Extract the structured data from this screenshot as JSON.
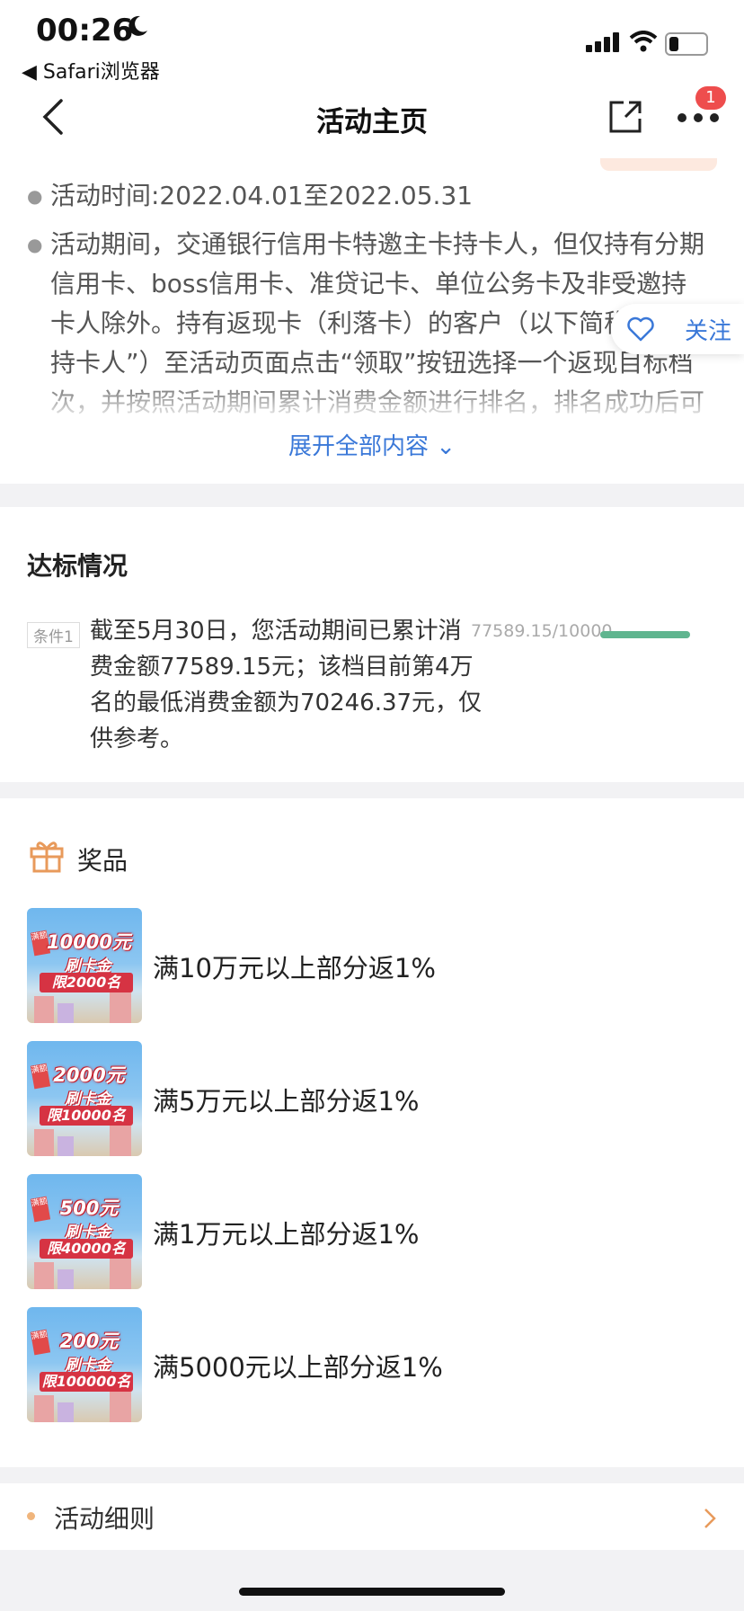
{
  "status": {
    "time": "00:26",
    "back_app": "◀ Safari浏览器"
  },
  "nav": {
    "title": "活动主页",
    "badge": "1"
  },
  "intro": {
    "time_text": "活动时间:2022.04.01至2022.05.31",
    "desc": "活动期间，交通银行信用卡特邀主卡持卡人，但仅持有分期信用卡、boss信用卡、准贷记卡、单位公务卡及非受邀持卡人除外。持有返现卡（利落卡）的客户（以下简称“特邀持卡人”）至活动页面点击“领取”按钮选择一个返现目标档次，并按照活动期间累计消费金额进行排名，排名成功后可按档次规则获返刷卡金奖励",
    "expand": "展开全部内容 ⌄"
  },
  "follow": {
    "label": "关注"
  },
  "qualify": {
    "title": "达标情况",
    "cond_tag": "条件1",
    "text": "截至5月30日，您活动期间已累计消费金额77589.15元；该档目前第4万名的最低消费金额为70246.37元，仅供参考。",
    "progress_text": "77589.15/10000",
    "progress": 1.0
  },
  "prizes": {
    "title": "奖品",
    "items": [
      {
        "amount": "10000元",
        "sub": "刷卡金",
        "limit": "限2000名",
        "label": "满10万元以上部分返1%"
      },
      {
        "amount": "2000元",
        "sub": "刷卡金",
        "limit": "限10000名",
        "label": "满5万元以上部分返1%"
      },
      {
        "amount": "500元",
        "sub": "刷卡金",
        "limit": "限40000名",
        "label": "满1万元以上部分返1%"
      },
      {
        "amount": "200元",
        "sub": "刷卡金",
        "limit": "限100000名",
        "label": "满5000元以上部分返1%"
      }
    ]
  },
  "rules": {
    "label": "活动细则"
  },
  "colors": {
    "accent": "#3a78d8",
    "progress": "#5fb58f",
    "badge": "#ee4d4d"
  }
}
